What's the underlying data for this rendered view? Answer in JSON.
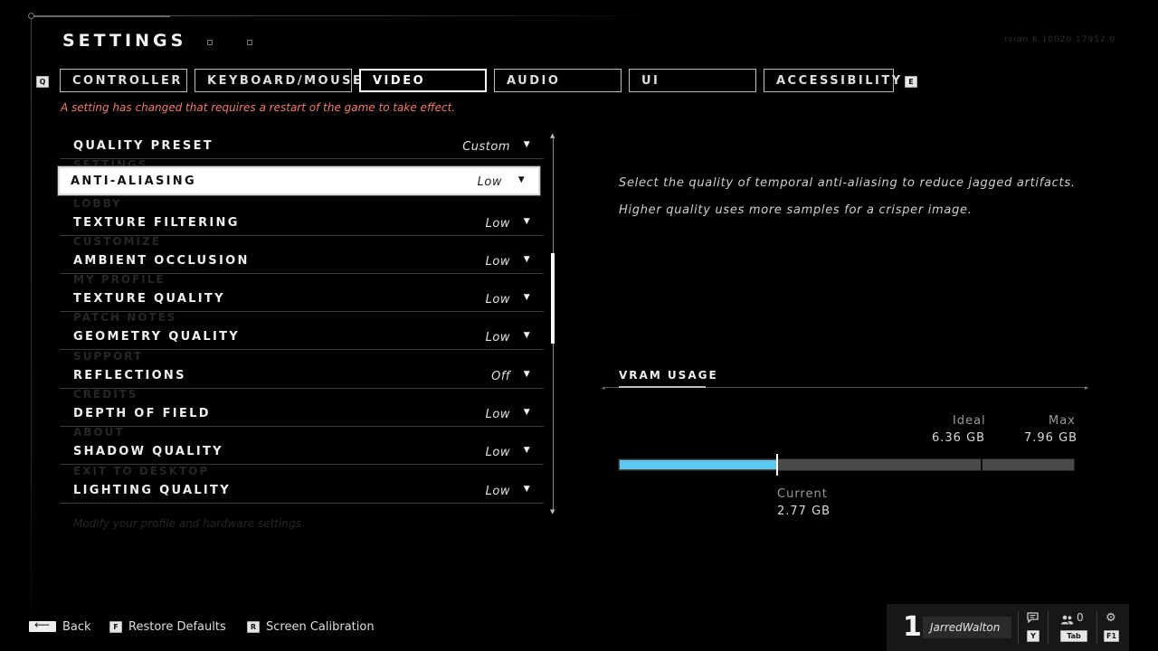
{
  "header": {
    "title": "SETTINGS",
    "version": "rsion 6.10020.17952.0",
    "left_key": "Q",
    "right_key": "E"
  },
  "tabs": [
    {
      "label": "CONTROLLER"
    },
    {
      "label": "KEYBOARD/MOUSE"
    },
    {
      "label": "VIDEO",
      "active": true
    },
    {
      "label": "AUDIO"
    },
    {
      "label": "UI"
    },
    {
      "label": "ACCESSIBILITY"
    }
  ],
  "restart_notice": "A setting has changed that requires a restart of the game to take effect.",
  "settings": [
    {
      "label": "QUALITY PRESET",
      "value": "Custom"
    },
    {
      "label": "ANTI-ALIASING",
      "value": "Low",
      "selected": true
    },
    {
      "label": "TEXTURE FILTERING",
      "value": "Low"
    },
    {
      "label": "AMBIENT OCCLUSION",
      "value": "Low"
    },
    {
      "label": "TEXTURE QUALITY",
      "value": "Low"
    },
    {
      "label": "GEOMETRY QUALITY",
      "value": "Low"
    },
    {
      "label": "REFLECTIONS",
      "value": "Off"
    },
    {
      "label": "DEPTH OF FIELD",
      "value": "Low"
    },
    {
      "label": "SHADOW QUALITY",
      "value": "Low"
    },
    {
      "label": "LIGHTING QUALITY",
      "value": "Low"
    }
  ],
  "ghost_menu": [
    "SETTINGS",
    "LOBBY",
    "CUSTOMIZE",
    "MY PROFILE",
    "PATCH NOTES",
    "SUPPORT",
    "CREDITS",
    "ABOUT",
    "EXIT TO DESKTOP"
  ],
  "ghost_footer": "Modify your profile and hardware settings.",
  "description": {
    "line1": "Select the quality of temporal anti-aliasing to reduce jagged artifacts.",
    "line2": "Higher quality uses more samples for a crisper image."
  },
  "vram": {
    "title": "VRAM USAGE",
    "ideal_label": "Ideal",
    "ideal_value": "6.36 GB",
    "max_label": "Max",
    "max_value": "7.96 GB",
    "current_label": "Current",
    "current_value": "2.77 GB",
    "current_gb": 2.77,
    "ideal_gb": 6.36,
    "max_gb": 7.96,
    "fill_color": "#5ec8f0"
  },
  "bottom_bar": {
    "back_label": "Back",
    "restore_key": "F",
    "restore_label": "Restore Defaults",
    "calib_key": "R",
    "calib_label": "Screen Calibration"
  },
  "player": {
    "number": "1",
    "name": "JarredWalton",
    "chat_key": "Y",
    "friends_count": "0",
    "friends_key": "Tab",
    "settings_key": "F1"
  }
}
